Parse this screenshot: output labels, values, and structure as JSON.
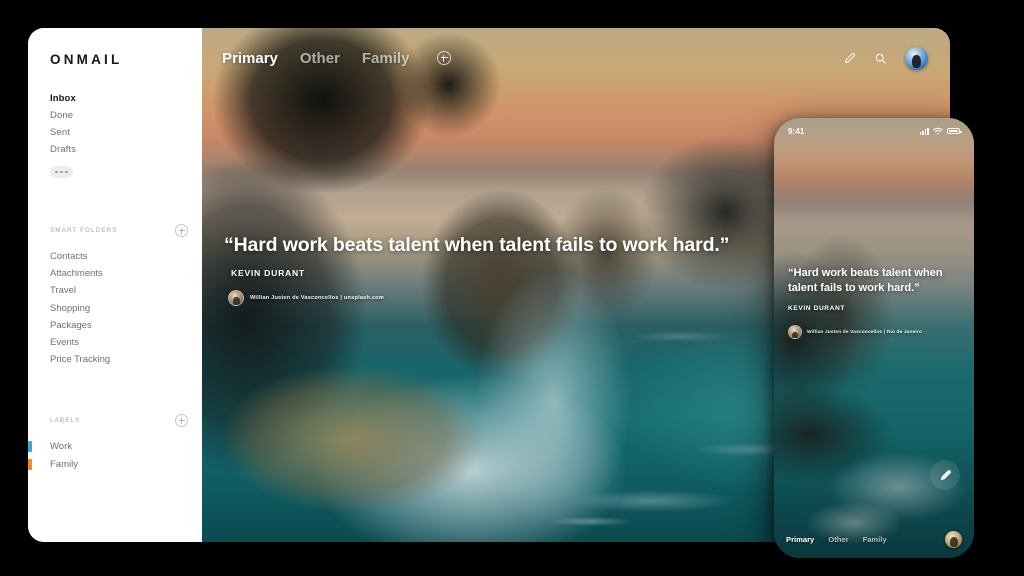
{
  "app": {
    "brand": "ONMAIL"
  },
  "sidebar": {
    "primary_nav": [
      {
        "label": "Inbox",
        "active": true
      },
      {
        "label": "Done",
        "active": false
      },
      {
        "label": "Sent",
        "active": false
      },
      {
        "label": "Drafts",
        "active": false
      }
    ],
    "more_button": "more-options",
    "smart_folders": {
      "title": "SMART FOLDERS",
      "add_label": "add-smart-folder",
      "items": [
        "Contacts",
        "Attachments",
        "Travel",
        "Shopping",
        "Packages",
        "Events",
        "Price Tracking"
      ]
    },
    "labels": {
      "title": "LABELS",
      "add_label": "add-label",
      "items": [
        {
          "label": "Work",
          "color": "#3aa8d8"
        },
        {
          "label": "Family",
          "color": "#f08a1e"
        }
      ]
    }
  },
  "tablet": {
    "tabs": [
      {
        "label": "Primary",
        "active": true
      },
      {
        "label": "Other",
        "active": false
      },
      {
        "label": "Family",
        "active": false
      }
    ],
    "add_tab": "add-tab",
    "actions": {
      "compose": "compose-icon",
      "search": "search-icon",
      "avatar": "user-avatar"
    },
    "quote": {
      "text": "“Hard work beats talent when talent fails to work hard.”",
      "author": "KEVIN DURANT",
      "credit": "Willian Justen de Vasconcellos | unsplash.com"
    }
  },
  "phone": {
    "status": {
      "time": "9:41",
      "signal": "cellular-signal-icon",
      "wifi": "wifi-icon",
      "battery": "battery-icon"
    },
    "quote": {
      "text": "“Hard work beats talent when talent fails to work hard.”",
      "author": "KEVIN DURANT",
      "credit": "Willian Justen de Vasconcellos | Rio de Janeiro"
    },
    "fab": "compose-fab",
    "tabs": [
      {
        "label": "Primary",
        "active": true
      },
      {
        "label": "Other",
        "active": false
      },
      {
        "label": "Family",
        "active": false
      }
    ],
    "avatar": "user-avatar"
  },
  "theme": {
    "background": "#000000",
    "surface": "#ffffff",
    "text_primary": "#15161a",
    "text_muted": "#6d6f76",
    "label_work": "#3aa8d8",
    "label_family": "#f08a1e",
    "ocean": "#14666b",
    "sunset": "#e2a071"
  }
}
